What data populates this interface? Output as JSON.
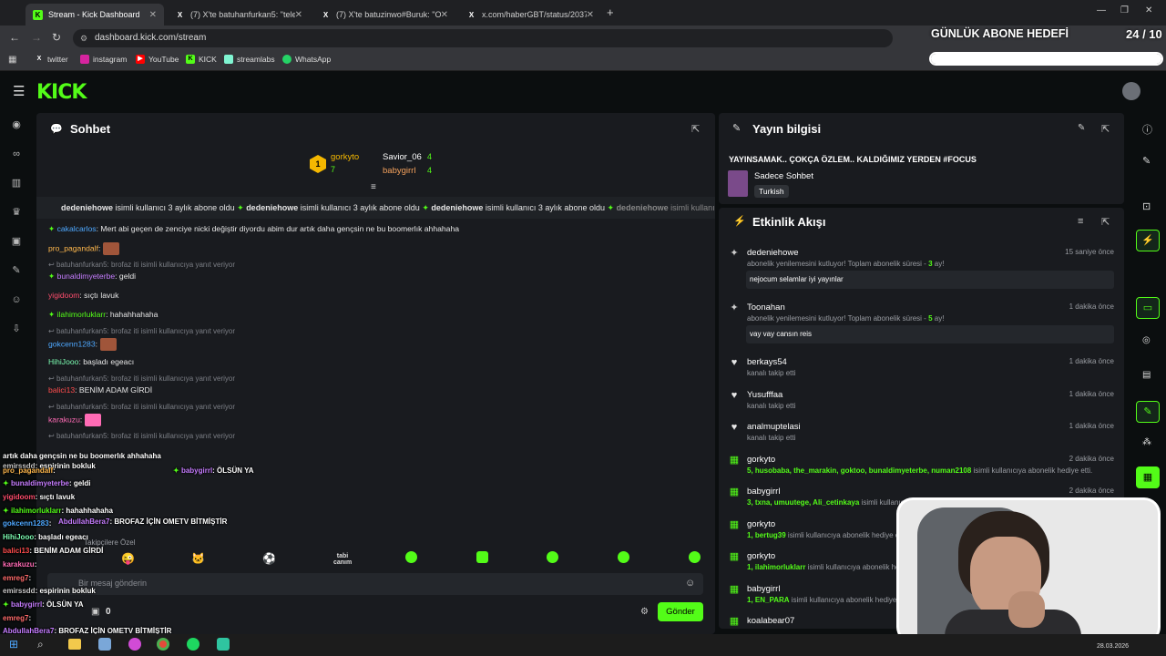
{
  "browser": {
    "tabs": [
      {
        "label": "Stream - Kick Dashboard",
        "icon": "kick-icon",
        "active": true
      },
      {
        "label": "(7) X'te batuhanfurkan5: \"telefo",
        "icon": "x-icon"
      },
      {
        "label": "(7) X'te batuzinwo#Buruk: \"Oğlu",
        "icon": "x-icon"
      },
      {
        "label": "x.com/haberGBT/status/203785",
        "icon": "x-icon"
      }
    ],
    "url": "dashboard.kick.com/stream",
    "bookmarks": [
      "twitter",
      "instagram",
      "YouTube",
      "KICK",
      "streamlabs",
      "WhatsApp"
    ]
  },
  "overlay": {
    "goal_title": "GÜNLÜK ABONE HEDEFİ",
    "goal_count": "24 / 10",
    "goal_progress": 1.0,
    "clock": "28.03.2026"
  },
  "chat": {
    "title": "Sohbet",
    "leaderboard": [
      {
        "name": "gorkyto",
        "count": "7",
        "rank": "1"
      },
      {
        "name": "Savior_06",
        "count": "4"
      },
      {
        "name": "babygirrl",
        "count": "4"
      }
    ],
    "ticker": [
      {
        "user": "dedeniehowe",
        "text": "isimli kullanıcı 3 aylık abone oldu"
      },
      {
        "user": "dedeniehowe",
        "text": "isimli kullanıcı 3 aylık abone oldu"
      },
      {
        "user": "dedeniehowe",
        "text": "isimli kullanıcı 3 aylık abone oldu"
      },
      {
        "user": "dedeniehowe",
        "text": "isimli kullanıcı 3 aylık abone oldu"
      }
    ],
    "messages": [
      {
        "user": "cakalcarlos",
        "text": ": Mert abi geçen de zenciye nicki değiştir diyordu abim dur artık daha gençsin ne bu boomerlık ahhahaha",
        "color": "#4ea8ff",
        "badge": true
      },
      {
        "user": "pro_pagandalf",
        "text": ":",
        "color": "#ffb84d",
        "emote": true
      },
      {
        "reply": "batuhanfurkan5: brofaz iti isimli kullanıcıya yanıt veriyor"
      },
      {
        "user": "bunaldimyeterbe",
        "text": ": geldi",
        "color": "#c67dff",
        "badge": true
      },
      {
        "user": "yigidoom",
        "text": ": sıçtı lavuk",
        "color": "#ff4d6d"
      },
      {
        "user": "ilahimorluklarr",
        "text": ": hahahhahaha",
        "color": "#53fc18",
        "badge": true
      },
      {
        "reply": "batuhanfurkan5: brofaz iti isimli kullanıcıya yanıt veriyor"
      },
      {
        "user": "gokcenn1283",
        "text": ":",
        "color": "#4ea8ff",
        "emote": true
      },
      {
        "user": "HihiJooo",
        "text": ": başladı egeacı",
        "color": "#7dffb3"
      },
      {
        "reply": "batuhanfurkan5: brofaz iti isimli kullanıcıya yanıt veriyor"
      },
      {
        "user": "balici13",
        "text": ": BENİM ADAM GİRDİ",
        "color": "#ff4d4d"
      },
      {
        "reply": "batuhanfurkan5: brofaz iti isimli kullanıcıya yanıt veriyor"
      },
      {
        "user": "karakuzu",
        "text": ":",
        "color": "#ff6bb5",
        "emote": true
      },
      {
        "reply": "batuhanfurkan5: brofaz iti isimli kullanıcıya yanıt veriyor"
      }
    ],
    "followers_label": "Takipçilere Özel",
    "emote_row": [
      "tabi canım"
    ],
    "input_placeholder": "Bir mesaj gönderin",
    "viewer_count": "0",
    "send_label": "Gönder"
  },
  "stream_info": {
    "title": "Yayın bilgisi",
    "stream_title": "YAYINSAMAK.. ÇOKÇA ÖZLEM.. KALDIĞIMIZ YERDEN #FOCUS",
    "category": "Sadece Sohbet",
    "language": "Turkish"
  },
  "feed": {
    "title": "Etkinlik Akışı",
    "items": [
      {
        "user": "dedeniehowe",
        "time": "15 saniye önce",
        "type": "resub",
        "desc": "abonelik yenilemesini kutluyor! Toplam abonelik süresi - ",
        "months": "3",
        "suffix": " ay!",
        "message": "nejocum selamlar iyi yayınlar"
      },
      {
        "user": "Toonahan",
        "time": "1 dakika önce",
        "type": "resub",
        "desc": "abonelik yenilemesini kutluyor! Toplam abonelik süresi - ",
        "months": "5",
        "suffix": " ay!",
        "message": "vay vay cansın reis"
      },
      {
        "user": "berkays54",
        "time": "1 dakika önce",
        "type": "follow",
        "desc": "kanalı takip etti"
      },
      {
        "user": "Yusufffaa",
        "time": "1 dakika önce",
        "type": "follow",
        "desc": "kanalı takip etti"
      },
      {
        "user": "analmuptelasi",
        "time": "1 dakika önce",
        "type": "follow",
        "desc": "kanalı takip etti"
      },
      {
        "user": "gorkyto",
        "time": "2 dakika önce",
        "type": "gift",
        "gifted": "5, husobaba, the_marakin, goktoo, bunaldimyeterbe, numan2108",
        "desc": " isimli kullanıcıya abonelik hediye etti."
      },
      {
        "user": "babygirrl",
        "time": "2 dakika önce",
        "type": "gift",
        "gifted": "3, txna, umuutege, Ali_cetinkaya",
        "desc": " isimli kullanıcıya abonelik hediye etti."
      },
      {
        "user": "gorkyto",
        "time": "",
        "type": "gift",
        "gifted": "1, bertug39",
        "desc": " isimli kullanıcıya abonelik hediye etti."
      },
      {
        "user": "gorkyto",
        "time": "",
        "type": "gift",
        "gifted": "1, ilahimorluklarr",
        "desc": " isimli kullanıcıya abonelik hediye etti."
      },
      {
        "user": "babygirrl",
        "time": "",
        "type": "gift",
        "gifted": "1, EN_PARA",
        "desc": " isimli kullanıcıya abonelik hediye etti."
      },
      {
        "user": "koalabear07",
        "time": "",
        "type": "gift",
        "gifted": "",
        "desc": ""
      }
    ]
  },
  "overlay_chat": [
    {
      "user": "",
      "text": "artık daha gençsin ne bu boomerlık ahhahaha"
    },
    {
      "user": "emirssdd",
      "text": ": espirinin bokluk",
      "color": "#c8c8c8"
    },
    {
      "user": "pro_pagandalf",
      "text": ":",
      "color": "#ffb84d"
    },
    {
      "user": "bunaldimyeterbe",
      "text": ": geldi",
      "color": "#c67dff"
    },
    {
      "user": "yigidoom",
      "text": ": sıçtı lavuk",
      "color": "#ff4d6d"
    },
    {
      "user": "ilahimorluklarr",
      "text": ": hahahhahaha",
      "color": "#53fc18"
    },
    {
      "user": "gokcenn1283",
      "text": ":",
      "color": "#4ea8ff"
    },
    {
      "user": "HihiJooo",
      "text": ": başladı egeacı",
      "color": "#7dffb3"
    },
    {
      "user": "balici13",
      "text": ": BENİM ADAM GİRDİ",
      "color": "#ff4d4d"
    },
    {
      "user": "karakuzu",
      "text": ":",
      "color": "#ff6bb5"
    },
    {
      "user": "emreg7",
      "text": ":",
      "color": "#ff6b6b"
    },
    {
      "user": "emirssdd",
      "text": ": espirinin bokluk",
      "color": "#c8c8c8"
    },
    {
      "user": "babygirrl",
      "text": ": ÖLSÜN YA",
      "color": "#c67dff"
    },
    {
      "user": "emreg7",
      "text": ":",
      "color": "#ff6b6b"
    },
    {
      "user": "AbdullahBera7",
      "text": ": BROFAZ İÇİN OMETV BİTMİŞTİR",
      "color": "#c67dff"
    }
  ],
  "colors": {
    "accent": "#53fc18",
    "panel": "#191b1f",
    "bg": "#0b0e0f"
  }
}
